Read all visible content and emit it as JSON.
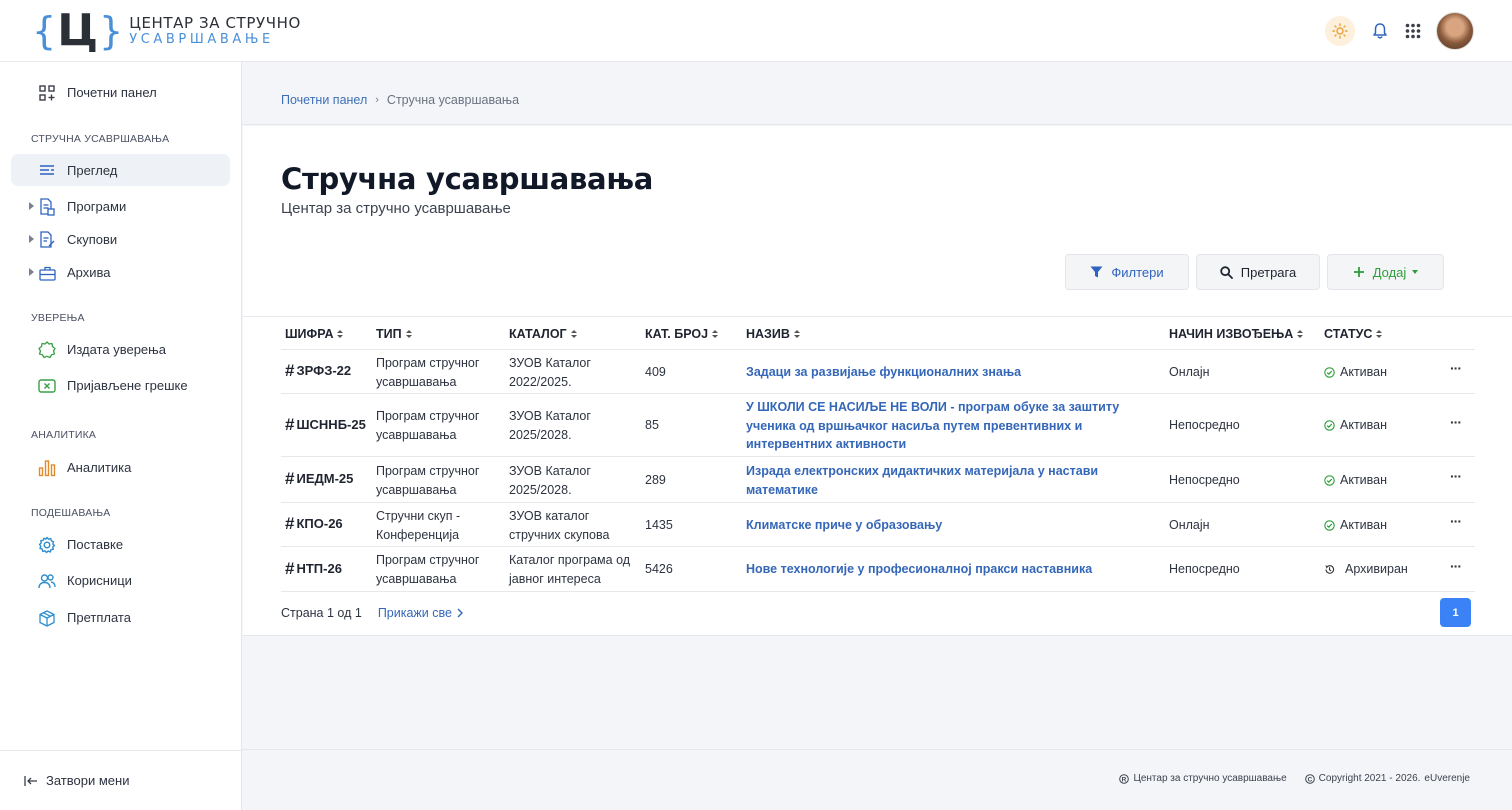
{
  "logo": {
    "letter": "Ц",
    "brace_left": "{",
    "brace_right": "}",
    "line1": "ЦЕНТАР ЗА СТРУЧНО",
    "line2": "УСАВРШАВАЊЕ"
  },
  "sidebar": {
    "home": "Почетни панел",
    "sections": {
      "training": "СТРУЧНА УСАВРШАВАЊА",
      "certificates": "УВЕРЕЊА",
      "analytics": "АНАЛИТИКА",
      "settings": "ПОДЕШАВАЊА"
    },
    "items": {
      "overview": "Преглед",
      "programs": "Програми",
      "gatherings": "Скупови",
      "archive": "Архива",
      "issued": "Издата уверења",
      "reported": "Пријављене грешке",
      "analytics": "Аналитика",
      "settings": "Поставке",
      "users": "Корисници",
      "subscription": "Претплата"
    },
    "close_menu": "Затвори мени"
  },
  "breadcrumb": {
    "home": "Почетни панел",
    "current": "Стручна усавршавања"
  },
  "page": {
    "title": "Стручна усавршавања",
    "subtitle": "Центар за стручно усавршавање"
  },
  "toolbar": {
    "filters": "Филтери",
    "search": "Претрага",
    "add": "Додај"
  },
  "table": {
    "headers": {
      "code": "ШИФРА",
      "type": "ТИП",
      "catalog": "КАТАЛОГ",
      "cat_no": "КАТ. БРОЈ",
      "name": "НАЗИВ",
      "mode": "НАЧИН ИЗВОЂЕЊА",
      "status": "СТАТУС"
    },
    "rows": [
      {
        "code": "ЗРФЗ-22",
        "type": [
          "Програм стручног",
          "усавршавања"
        ],
        "catalog": [
          "ЗУОВ Каталог",
          "2022/2025."
        ],
        "cat_no": "409",
        "name": [
          "Задаци за развијање функционалних знања"
        ],
        "mode": "Онлајн",
        "status": "Активан",
        "status_kind": "active"
      },
      {
        "code": "ШСННБ-25",
        "type": [
          "Програм стручног",
          "усавршавања"
        ],
        "catalog": [
          "ЗУОВ Каталог",
          "2025/2028."
        ],
        "cat_no": "85",
        "name": [
          "У ШКОЛИ СЕ НАСИЉЕ НЕ ВОЛИ - програм обуке за заштиту",
          "ученика од вршњачког насиља путем превентивних и",
          "интервентних активности"
        ],
        "mode": "Непосредно",
        "status": "Активан",
        "status_kind": "active"
      },
      {
        "code": "ИЕДМ-25",
        "type": [
          "Програм стручног",
          "усавршавања"
        ],
        "catalog": [
          "ЗУОВ Каталог",
          "2025/2028."
        ],
        "cat_no": "289",
        "name": [
          "Израда електронских дидактичких материјала у настави",
          "математике"
        ],
        "mode": "Непосредно",
        "status": "Активан",
        "status_kind": "active"
      },
      {
        "code": "КПО-26",
        "type": [
          "Стручни скуп -",
          "Конференција"
        ],
        "catalog": [
          "ЗУОВ каталог",
          "стручних скупова"
        ],
        "cat_no": "1435",
        "name": [
          "Климатске приче у образовању"
        ],
        "mode": "Онлајн",
        "status": "Активан",
        "status_kind": "active"
      },
      {
        "code": "НТП-26",
        "type": [
          "Програм стручног",
          "усавршавања"
        ],
        "catalog": [
          "Каталог програма од",
          "јавног интереса"
        ],
        "cat_no": "5426",
        "name": [
          "Нове технологије у професионалној пракси наставника"
        ],
        "mode": "Непосредно",
        "status": "Архивиран",
        "status_kind": "archived"
      }
    ]
  },
  "pager": {
    "label": "Страна 1 од 1",
    "show_all": "Прикажи све",
    "page": "1"
  },
  "footer": {
    "org": "Центар за стручно усавршавање",
    "copyright": "Copyright 2021 - 2026.",
    "brand": "eUverenje"
  },
  "colors": {
    "accent": "#3b82f6",
    "link": "#3567b8",
    "active_green": "#2e9e3a"
  }
}
